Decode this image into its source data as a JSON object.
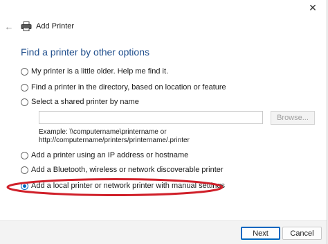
{
  "window": {
    "title": "Add Printer",
    "close_glyph": "✕",
    "back_glyph": "←"
  },
  "heading": "Find a printer by other options",
  "options": [
    {
      "label": "My printer is a little older. Help me find it.",
      "checked": false
    },
    {
      "label": "Find a printer in the directory, based on location or feature",
      "checked": false
    },
    {
      "label": "Select a shared printer by name",
      "checked": false
    },
    {
      "label": "Add a printer using an IP address or hostname",
      "checked": false
    },
    {
      "label": "Add a Bluetooth, wireless or network discoverable printer",
      "checked": false
    },
    {
      "label": "Add a local printer or network printer with manual settings",
      "checked": true
    }
  ],
  "shared_printer": {
    "input_value": "",
    "browse_label": "Browse...",
    "example_line1": "Example: \\\\computername\\printername or",
    "example_line2": "http://computername/printers/printername/.printer"
  },
  "footer": {
    "next_label": "Next",
    "cancel_label": "Cancel"
  },
  "colors": {
    "accent": "#0067c0",
    "heading": "#1f4e8c",
    "annotation": "#d0202a"
  }
}
